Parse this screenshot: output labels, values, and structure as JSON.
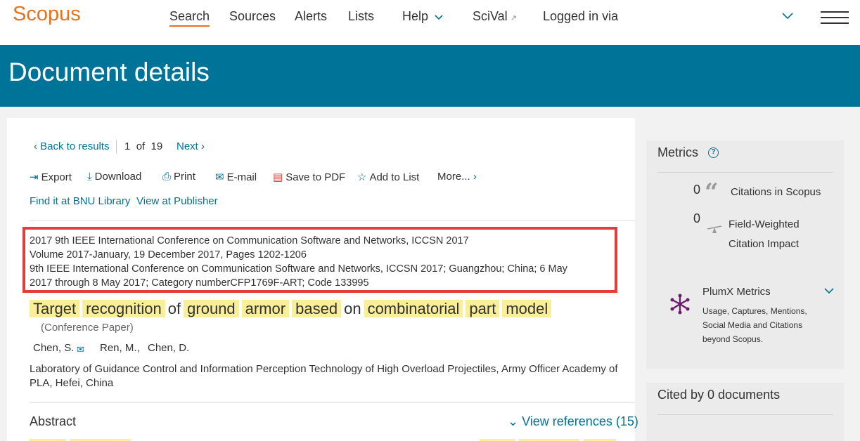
{
  "nav": {
    "logo": "Scopus",
    "items": [
      "Search",
      "Sources",
      "Alerts",
      "Lists",
      "Help",
      "SciVal",
      "Logged in via"
    ]
  },
  "banner": {
    "title": "Document details"
  },
  "result_nav": {
    "back": "Back to results",
    "position": "1",
    "of": "of",
    "total": "19",
    "next": "Next"
  },
  "toolbar": {
    "export": "Export",
    "download": "Download",
    "print": "Print",
    "email": "E-mail",
    "save_pdf": "Save to PDF",
    "add_list": "Add to List",
    "more": "More..."
  },
  "library": {
    "find": "Find it at BNU Library",
    "publisher": "View at Publisher"
  },
  "source": {
    "line1": "2017 9th IEEE International Conference on Communication Software and Networks, ICCSN 2017",
    "line2": "Volume 2017-January, 19 December 2017, Pages 1202-1206",
    "line3": "9th IEEE International Conference on Communication Software and Networks, ICCSN 2017; Guangzhou; China; 6 May",
    "line4": "2017 through 8 May 2017; Category numberCFP1769F-ART; Code 133995"
  },
  "document": {
    "title_words": [
      "Target",
      "recognition",
      "of",
      "ground",
      "armor",
      "based",
      "on",
      "combinatorial",
      "part",
      "model"
    ],
    "doctype": "(Conference Paper)",
    "authors": [
      "Chen, S.",
      "Ren, M.,",
      "Chen, D."
    ],
    "affiliation": "Laboratory of Guidance Control and Information Perception Technology of High Overload Projectiles, Army Officer Academy of PLA, Hefei, China"
  },
  "abstract": {
    "heading": "Abstract",
    "view_refs": "View references (15)"
  },
  "metrics": {
    "title": "Metrics",
    "citations_value": "0",
    "citations_label": "Citations in Scopus",
    "fwci_value": "0",
    "fwci_label": "Field-Weighted Citation Impact",
    "plumx_title": "PlumX Metrics",
    "plumx_desc": "Usage, Captures, Mentions, Social Media and Citations beyond Scopus."
  },
  "cited_by": {
    "title": "Cited by 0 documents"
  },
  "colors": {
    "brand": "#e9711c",
    "accent": "#007398",
    "highlight": "#faef99",
    "box": "#e63c3c"
  }
}
